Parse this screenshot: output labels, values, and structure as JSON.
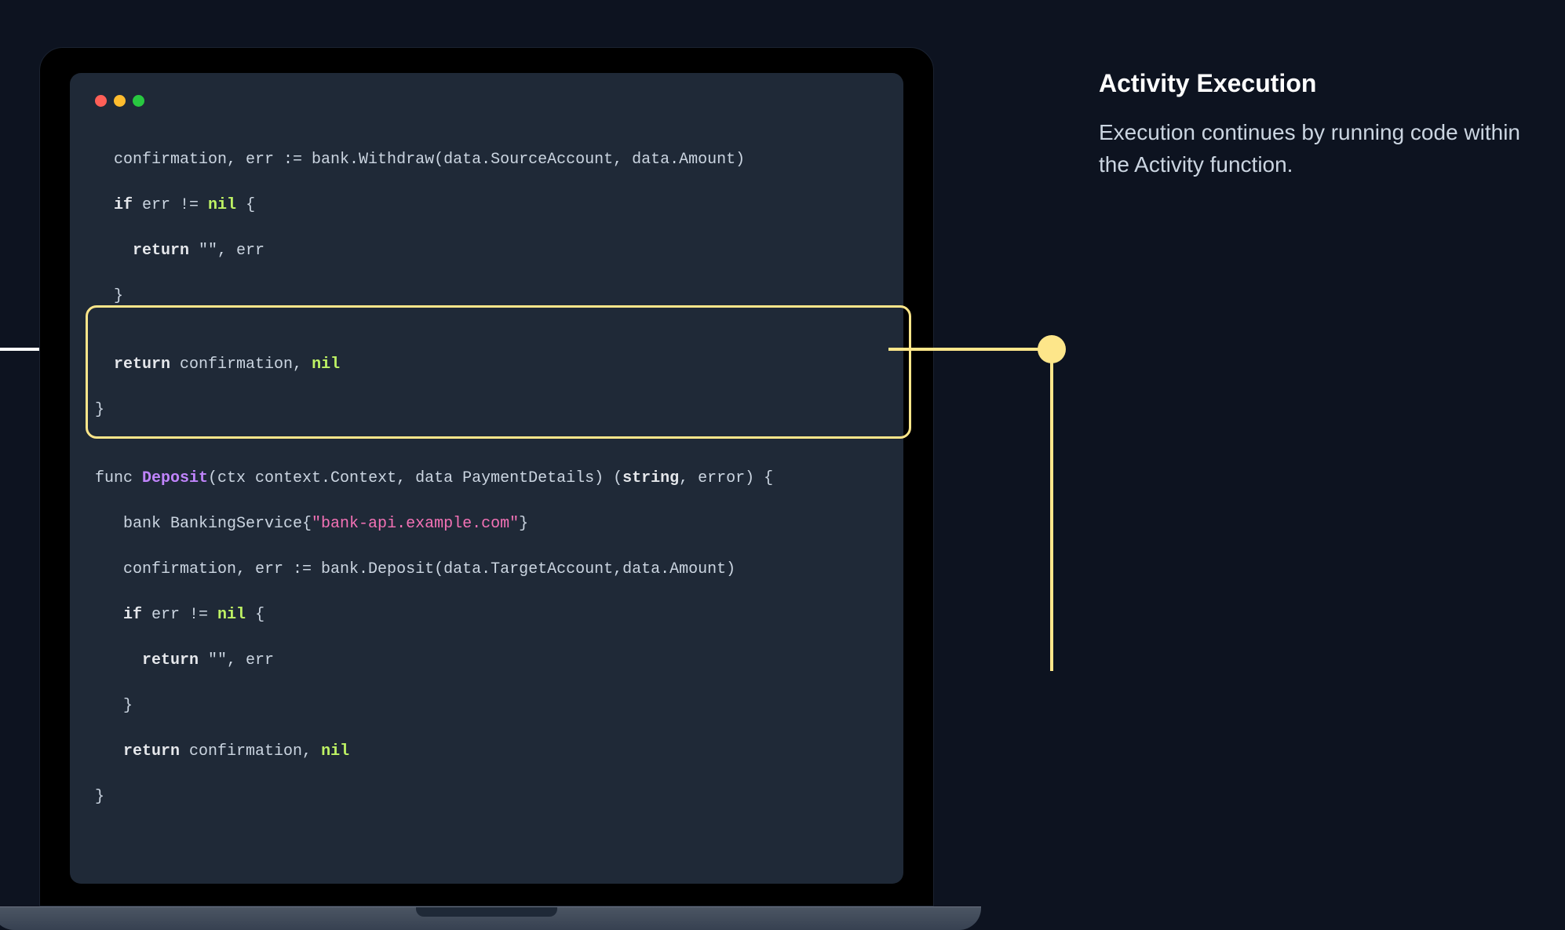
{
  "sidebar": {
    "title": "Activity Execution",
    "body": "Execution continues by running code within the Activity function."
  },
  "code": {
    "l1_pre": "  confirmation, err := bank.Withdraw(data.SourceAccount, data.Amount)",
    "l2_if": "if",
    "l2_rest": " err != ",
    "l2_nil": "nil",
    "l2_br": " {",
    "l3_ret": "return",
    "l3_rest": " \"\", err",
    "l4": "  }",
    "l5": "",
    "l6_ret": "return",
    "l6_rest": " confirmation, ",
    "l6_nil": "nil",
    "l7": "}",
    "l8": "",
    "l9_func": "func ",
    "l9_name": "Deposit",
    "l9_sig1": "(ctx context.Context, data PaymentDetails) (",
    "l9_str": "string",
    "l9_sig2": ", error) {",
    "l10_pre": "   bank BankingService{",
    "l10_str": "\"bank-api.example.com\"",
    "l10_end": "}",
    "l11": "   confirmation, err := bank.Deposit(data.TargetAccount,data.Amount)",
    "l12_if": "if",
    "l12_rest": " err != ",
    "l12_nil": "nil",
    "l12_br": " {",
    "l13_ret": "return",
    "l13_rest": " \"\", err",
    "l14": "   }",
    "l15_ret": "return",
    "l15_rest": " confirmation, ",
    "l15_nil": "nil",
    "l16": "}"
  },
  "colors": {
    "highlight": "#fde68a",
    "background": "#0d1320",
    "codeBg": "#1f2937"
  }
}
